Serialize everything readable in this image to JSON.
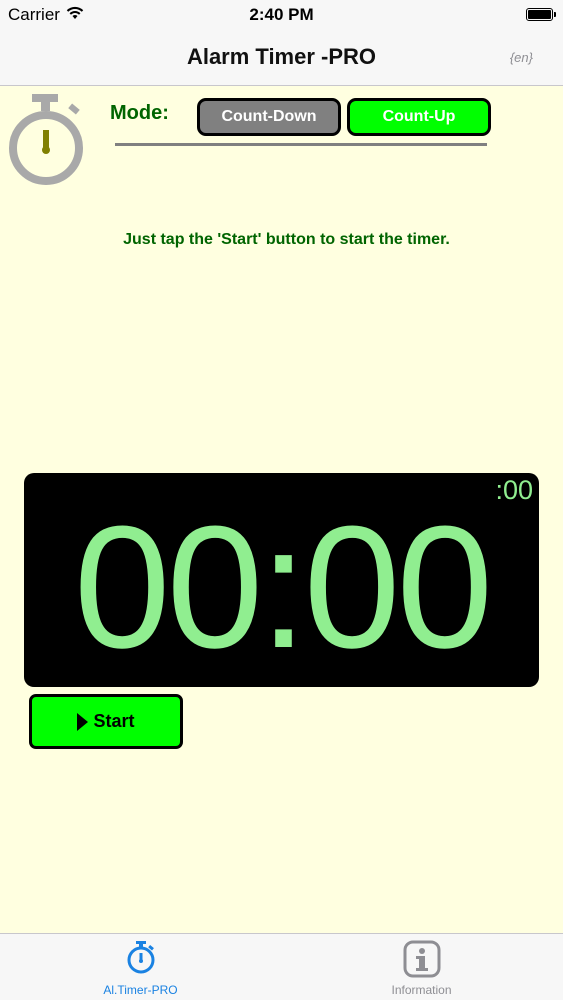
{
  "status_bar": {
    "carrier": "Carrier",
    "time": "2:40 PM"
  },
  "nav": {
    "title": "Alarm Timer -PRO",
    "lang": "{en}"
  },
  "mode": {
    "label": "Mode:",
    "count_down": "Count-Down",
    "count_up": "Count-Up",
    "selected": "Count-Up"
  },
  "hint": "Just tap the 'Start' button to start the timer.",
  "timer": {
    "main": "00:00",
    "seconds": ":00"
  },
  "start_button": "Start",
  "tabs": [
    {
      "label": "Al.Timer-PRO",
      "icon": "stopwatch-icon",
      "active": true
    },
    {
      "label": "Information",
      "icon": "info-icon",
      "active": false
    }
  ],
  "colors": {
    "background": "#ffffe0",
    "accent_green": "#00ff00",
    "text_green": "#006400",
    "digit_green": "#90ee90",
    "tab_active": "#1a82e2",
    "mode_inactive": "#808080"
  }
}
